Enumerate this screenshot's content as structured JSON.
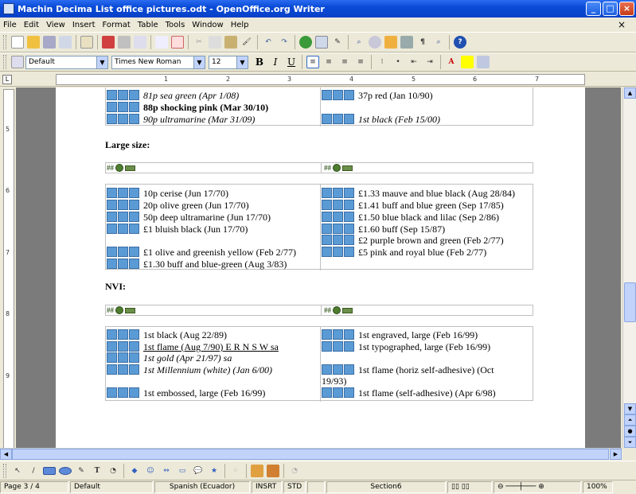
{
  "window": {
    "title": "Machin Decima List office pictures.odt - OpenOffice.org Writer",
    "minimize": "_",
    "maximize": "□",
    "close": "×"
  },
  "menu": [
    "File",
    "Edit",
    "View",
    "Insert",
    "Format",
    "Table",
    "Tools",
    "Window",
    "Help"
  ],
  "menu_close": "×",
  "format_toolbar": {
    "style": "Default",
    "font": "Times New Roman",
    "size": "12",
    "bold": "B",
    "italic": "I",
    "underline": "U"
  },
  "ruler": {
    "marks": [
      "1",
      "2",
      "3",
      "4",
      "5",
      "6",
      "7"
    ],
    "vmarks": [
      "5",
      "6",
      "7",
      "8",
      "9"
    ]
  },
  "document": {
    "top_table": {
      "left": [
        {
          "text": "81p sea green (Apr 1/08)",
          "style": "italic"
        },
        {
          "text": "88p shocking pink (Mar 30/10)",
          "style": "bold"
        },
        {
          "text": "90p ultramarine (Mar 31/09)",
          "style": "italic"
        }
      ],
      "right": [
        {
          "text": "37p red (Jan 10/90)",
          "style": "normal"
        },
        {
          "text": "1st black (Feb 15/00)",
          "style": "italic"
        }
      ]
    },
    "large_heading": "Large size:",
    "large_table": {
      "left": [
        {
          "text": "10p cerise (Jun 17/70)"
        },
        {
          "text": "20p olive green (Jun 17/70)"
        },
        {
          "text": "50p deep ultramarine (Jun 17/70)"
        },
        {
          "text": "£1 bluish black (Jun 17/70)"
        },
        {
          "text": "£1 olive and greenish yellow (Feb 2/77)"
        },
        {
          "text": "£1.30 buff and blue-green (Aug 3/83)"
        }
      ],
      "right": [
        {
          "text": "£1.33 mauve and blue black (Aug 28/84)"
        },
        {
          "text": "£1.41 buff and blue green (Sep 17/85)"
        },
        {
          "text": "£1.50 blue black and lilac (Sep 2/86)"
        },
        {
          "text": "£1.60 buff (Sep 15/87)"
        },
        {
          "text": "£2 purple brown and green (Feb 2/77)"
        },
        {
          "text": "£5 pink and royal blue (Feb 2/77)"
        }
      ]
    },
    "nvi_heading": "NVI:",
    "nvi_table": {
      "left": [
        {
          "text": "1st black (Aug 22/89)",
          "style": "normal"
        },
        {
          "text": "1st flame (Aug 7/90) E R N S W sa",
          "style": "underline"
        },
        {
          "text": "1st gold (Apr 21/97) sa",
          "style": "italic"
        },
        {
          "text": "1st Millennium (white) (Jan 6/00)",
          "style": "italic"
        },
        {
          "text": "1st embossed, large (Feb 16/99)",
          "style": "normal"
        }
      ],
      "right": [
        {
          "text": "1st engraved, large (Feb 16/99)"
        },
        {
          "text": "1st typographed, large (Feb 16/99)"
        },
        {
          "text": "1st flame (horiz self-adhesive) (Oct"
        },
        {
          "text": "19/93)"
        },
        {
          "text": "1st flame (self-adhesive) (Apr 6/98)"
        }
      ]
    },
    "icon_marks": "##"
  },
  "status": {
    "page": "Page 3 / 4",
    "page_style": "Default",
    "language": "Spanish (Ecuador)",
    "insert_mode": "INSRT",
    "selection_mode": "STD",
    "section": "Section6",
    "zoom": "100%"
  }
}
